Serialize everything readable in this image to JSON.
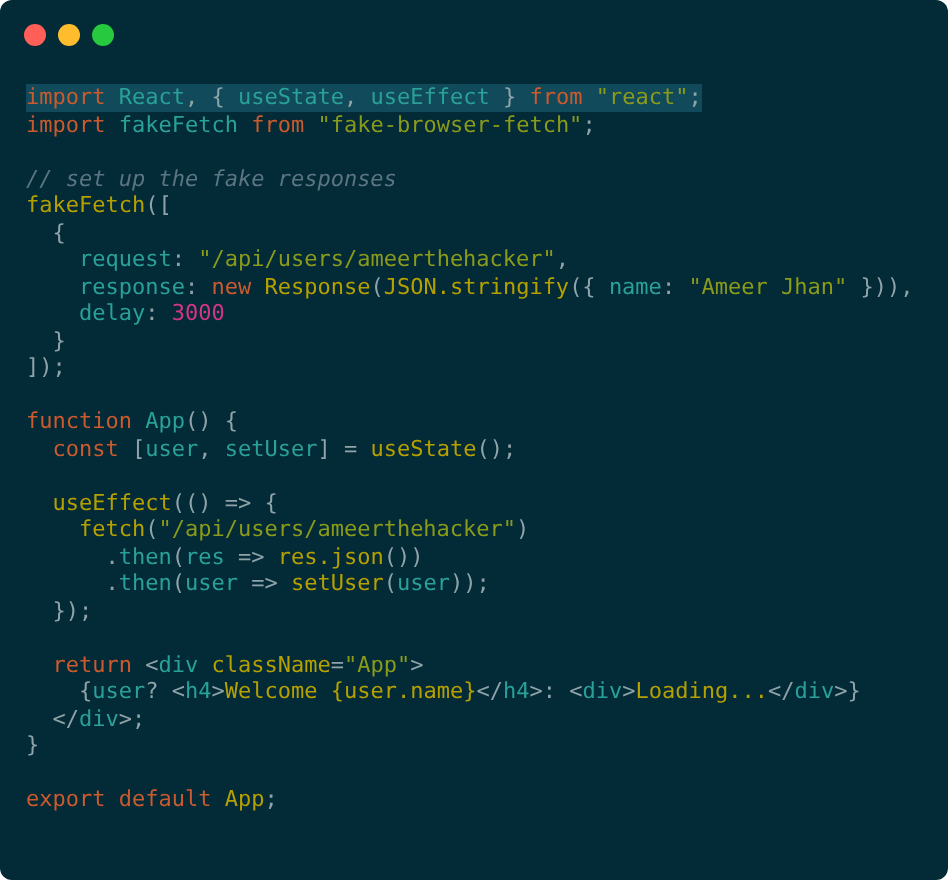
{
  "window": {
    "controls": [
      {
        "color": "#ff5f56"
      },
      {
        "color": "#ffbd2e"
      },
      {
        "color": "#27c93f"
      }
    ]
  },
  "code_lines": [
    {
      "kind": "code",
      "highlighted": true,
      "tokens": [
        {
          "kind": "keyword",
          "text": "import"
        },
        {
          "kind": "ident",
          "text": " React"
        },
        {
          "kind": "punct",
          "text": ", { "
        },
        {
          "kind": "ident",
          "text": "useState"
        },
        {
          "kind": "punct",
          "text": ", "
        },
        {
          "kind": "ident",
          "text": "useEffect"
        },
        {
          "kind": "punct",
          "text": " } "
        },
        {
          "kind": "keyword",
          "text": "from"
        },
        {
          "kind": "string",
          "text": " \"react\""
        },
        {
          "kind": "punct",
          "text": ";"
        }
      ]
    },
    {
      "kind": "code",
      "highlighted": false,
      "tokens": [
        {
          "kind": "keyword",
          "text": "import"
        },
        {
          "kind": "ident",
          "text": " fakeFetch"
        },
        {
          "kind": "keyword",
          "text": " from"
        },
        {
          "kind": "string",
          "text": " \"fake-browser-fetch\""
        },
        {
          "kind": "punct",
          "text": ";"
        }
      ]
    },
    {
      "kind": "blank"
    },
    {
      "kind": "code",
      "highlighted": false,
      "tokens": [
        {
          "kind": "comment",
          "text": "// set up the fake responses"
        }
      ]
    },
    {
      "kind": "code",
      "highlighted": false,
      "tokens": [
        {
          "kind": "func",
          "text": "fakeFetch"
        },
        {
          "kind": "punct",
          "text": "(["
        }
      ]
    },
    {
      "kind": "code",
      "highlighted": false,
      "tokens": [
        {
          "kind": "punct",
          "text": "  {"
        }
      ]
    },
    {
      "kind": "code",
      "highlighted": false,
      "tokens": [
        {
          "kind": "ident",
          "text": "    request"
        },
        {
          "kind": "punct",
          "text": ": "
        },
        {
          "kind": "string",
          "text": "\"/api/users/ameerthehacker\""
        },
        {
          "kind": "punct",
          "text": ","
        }
      ]
    },
    {
      "kind": "code",
      "highlighted": false,
      "tokens": [
        {
          "kind": "ident",
          "text": "    response"
        },
        {
          "kind": "punct",
          "text": ": "
        },
        {
          "kind": "keyword",
          "text": "new"
        },
        {
          "kind": "func",
          "text": " Response"
        },
        {
          "kind": "punct",
          "text": "("
        },
        {
          "kind": "func",
          "text": "JSON.stringify"
        },
        {
          "kind": "punct",
          "text": "({ "
        },
        {
          "kind": "ident",
          "text": "name"
        },
        {
          "kind": "punct",
          "text": ": "
        },
        {
          "kind": "string",
          "text": "\"Ameer Jhan\""
        },
        {
          "kind": "punct",
          "text": " })),"
        }
      ]
    },
    {
      "kind": "code",
      "highlighted": false,
      "tokens": [
        {
          "kind": "ident",
          "text": "    delay"
        },
        {
          "kind": "punct",
          "text": ": "
        },
        {
          "kind": "number",
          "text": "3000"
        }
      ]
    },
    {
      "kind": "code",
      "highlighted": false,
      "tokens": [
        {
          "kind": "punct",
          "text": "  }"
        }
      ]
    },
    {
      "kind": "code",
      "highlighted": false,
      "tokens": [
        {
          "kind": "punct",
          "text": "]);"
        }
      ]
    },
    {
      "kind": "blank"
    },
    {
      "kind": "code",
      "highlighted": false,
      "tokens": [
        {
          "kind": "keyword",
          "text": "function"
        },
        {
          "kind": "ident",
          "text": " App"
        },
        {
          "kind": "punct",
          "text": "() {"
        }
      ]
    },
    {
      "kind": "code",
      "highlighted": false,
      "tokens": [
        {
          "kind": "keyword",
          "text": "  const"
        },
        {
          "kind": "punct",
          "text": " ["
        },
        {
          "kind": "ident",
          "text": "user"
        },
        {
          "kind": "punct",
          "text": ", "
        },
        {
          "kind": "ident",
          "text": "setUser"
        },
        {
          "kind": "punct",
          "text": "] = "
        },
        {
          "kind": "func",
          "text": "useState"
        },
        {
          "kind": "punct",
          "text": "();"
        }
      ]
    },
    {
      "kind": "blank"
    },
    {
      "kind": "code",
      "highlighted": false,
      "tokens": [
        {
          "kind": "func",
          "text": "  useEffect"
        },
        {
          "kind": "punct",
          "text": "(() => {"
        }
      ]
    },
    {
      "kind": "code",
      "highlighted": false,
      "tokens": [
        {
          "kind": "func",
          "text": "    fetch"
        },
        {
          "kind": "punct",
          "text": "("
        },
        {
          "kind": "string",
          "text": "\"/api/users/ameerthehacker\""
        },
        {
          "kind": "punct",
          "text": ")"
        }
      ]
    },
    {
      "kind": "code",
      "highlighted": false,
      "tokens": [
        {
          "kind": "punct",
          "text": "      ."
        },
        {
          "kind": "ident",
          "text": "then"
        },
        {
          "kind": "punct",
          "text": "("
        },
        {
          "kind": "ident",
          "text": "res"
        },
        {
          "kind": "punct",
          "text": " => "
        },
        {
          "kind": "func",
          "text": "res.json"
        },
        {
          "kind": "punct",
          "text": "())"
        }
      ]
    },
    {
      "kind": "code",
      "highlighted": false,
      "tokens": [
        {
          "kind": "punct",
          "text": "      ."
        },
        {
          "kind": "ident",
          "text": "then"
        },
        {
          "kind": "punct",
          "text": "("
        },
        {
          "kind": "ident",
          "text": "user"
        },
        {
          "kind": "punct",
          "text": " => "
        },
        {
          "kind": "func",
          "text": "setUser"
        },
        {
          "kind": "punct",
          "text": "("
        },
        {
          "kind": "ident",
          "text": "user"
        },
        {
          "kind": "punct",
          "text": "));"
        }
      ]
    },
    {
      "kind": "code",
      "highlighted": false,
      "tokens": [
        {
          "kind": "punct",
          "text": "  });"
        }
      ]
    },
    {
      "kind": "blank"
    },
    {
      "kind": "code",
      "highlighted": false,
      "tokens": [
        {
          "kind": "keyword",
          "text": "  return"
        },
        {
          "kind": "punct",
          "text": " <"
        },
        {
          "kind": "tag",
          "text": "div"
        },
        {
          "kind": "func",
          "text": " className"
        },
        {
          "kind": "punct",
          "text": "="
        },
        {
          "kind": "string",
          "text": "\"App\""
        },
        {
          "kind": "punct",
          "text": ">"
        }
      ]
    },
    {
      "kind": "code",
      "highlighted": false,
      "tokens": [
        {
          "kind": "punct",
          "text": "    {"
        },
        {
          "kind": "ident",
          "text": "user"
        },
        {
          "kind": "punct",
          "text": "? <"
        },
        {
          "kind": "tag",
          "text": "h4"
        },
        {
          "kind": "punct",
          "text": ">"
        },
        {
          "kind": "func",
          "text": "Welcome {user.name}"
        },
        {
          "kind": "punct",
          "text": "</"
        },
        {
          "kind": "tag",
          "text": "h4"
        },
        {
          "kind": "punct",
          "text": ">: <"
        },
        {
          "kind": "tag",
          "text": "div"
        },
        {
          "kind": "punct",
          "text": ">"
        },
        {
          "kind": "func",
          "text": "Loading..."
        },
        {
          "kind": "punct",
          "text": "</"
        },
        {
          "kind": "tag",
          "text": "div"
        },
        {
          "kind": "punct",
          "text": ">}"
        }
      ]
    },
    {
      "kind": "code",
      "highlighted": false,
      "tokens": [
        {
          "kind": "punct",
          "text": "  </"
        },
        {
          "kind": "tag",
          "text": "div"
        },
        {
          "kind": "punct",
          "text": ">;"
        }
      ]
    },
    {
      "kind": "code",
      "highlighted": false,
      "tokens": [
        {
          "kind": "punct",
          "text": "}"
        }
      ]
    },
    {
      "kind": "blank"
    },
    {
      "kind": "code",
      "highlighted": false,
      "tokens": [
        {
          "kind": "keyword",
          "text": "export default"
        },
        {
          "kind": "func",
          "text": " App"
        },
        {
          "kind": "punct",
          "text": ";"
        }
      ]
    }
  ]
}
